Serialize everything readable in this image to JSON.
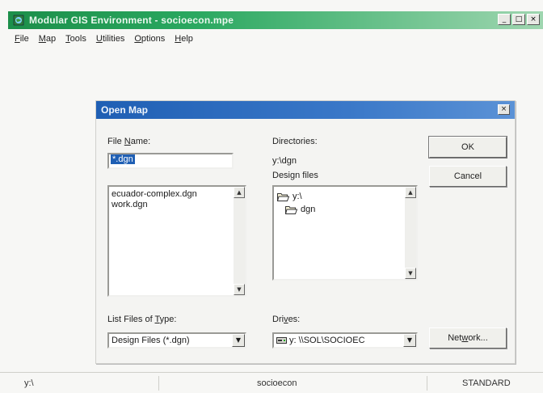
{
  "app": {
    "title": "Modular GIS Environment - socioecon.mpe",
    "window_controls": [
      "_",
      "□",
      "×"
    ],
    "menu": [
      {
        "key": "F",
        "rest": "ile"
      },
      {
        "key": "M",
        "rest": "ap"
      },
      {
        "key": "T",
        "rest": "ools"
      },
      {
        "key": "U",
        "rest": "tilities"
      },
      {
        "key": "O",
        "rest": "ptions"
      },
      {
        "key": "H",
        "rest": "elp"
      }
    ]
  },
  "dialog": {
    "title": "Open Map",
    "close_glyph": "×",
    "file_name": {
      "pre": "File ",
      "key": "N",
      "post": "ame:",
      "value": "*.dgn"
    },
    "file_list": [
      "ecuador-complex.dgn",
      "work.dgn"
    ],
    "directories": {
      "label": "Directories:",
      "path": "y:\\dgn",
      "design_files_label": "Design files"
    },
    "dir_tree": [
      {
        "name": "y:\\",
        "icon": "open-folder-icon"
      },
      {
        "name": "dgn",
        "icon": "open-folder-icon"
      }
    ],
    "list_type": {
      "pre": "List Files of ",
      "key": "T",
      "post": "ype:",
      "value": "Design Files (*.dgn)"
    },
    "drives": {
      "pre": "Dri",
      "key": "v",
      "post": "es:",
      "value": "y: \\\\SOL\\SOCIOEC"
    },
    "buttons": {
      "ok": "OK",
      "cancel": "Cancel",
      "network_pre": "Net",
      "network_key": "w",
      "network_post": "ork..."
    }
  },
  "status": {
    "left": "y:\\",
    "center": "socioecon",
    "right": "STANDARD"
  },
  "colors": {
    "app_title": "#1c8f4a",
    "dialog_title": "#1f5fb4",
    "selection": "#1f5fb4"
  }
}
